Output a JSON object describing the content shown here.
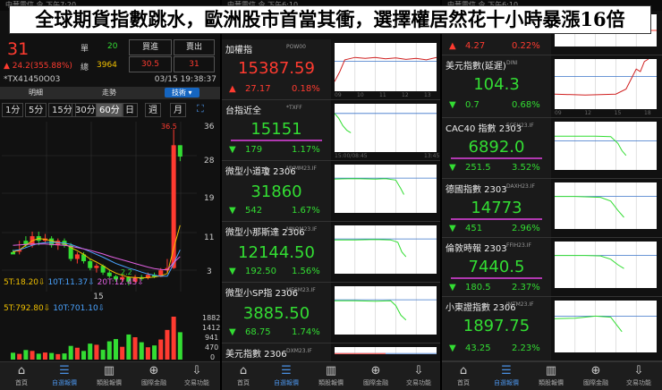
{
  "headline": "全球期貨指數跳水，歐洲股市首當其衝，選擇權居然花十小時暴漲16倍",
  "status": {
    "p1": "中華電信 令 下午7:20",
    "p2": "中華電信 令 下午6:10",
    "p3": "中華電信 令 下午6:10"
  },
  "panel1": {
    "price": "31",
    "change_arrow": "▲",
    "change": "24.2(355.88%)",
    "lbl_single": "單",
    "single": "20",
    "lbl_total": "總",
    "total": "3964",
    "lbl_buy": "買進",
    "buy": "30.5",
    "lbl_sell": "賣出",
    "sell": "31",
    "symbol": "*TX41450O03",
    "datetime": "03/15 19:38:37",
    "tabs": [
      "明細",
      "走勢",
      "技術 ▾"
    ],
    "intervals": [
      "1分",
      "5分",
      "15分",
      "30分",
      "60分",
      "日",
      "週",
      "月"
    ],
    "expand_icon": "⛶",
    "y_axis": [
      "36",
      "28",
      "19",
      "11",
      "3"
    ],
    "high_label": "36.5",
    "low_label": "2.2",
    "ma5": "5T:18.20⇩",
    "ma10": "10T:11.37⇩",
    "ma20": "20T:12.45⇩",
    "vol_top": "15",
    "vol5": "5T:792.80⇩",
    "vol10": "10T:701.10⇩",
    "vol_axis": [
      "1882",
      "1412",
      "941",
      "470",
      "0"
    ]
  },
  "panel2": {
    "rows": [
      {
        "name": "加權指",
        "code": "POW00",
        "price": "15387.59",
        "arrow": "▲",
        "change": "27.17",
        "pct": "0.18%",
        "dir": "up",
        "xt": [
          "09",
          "10",
          "11",
          "12",
          "13"
        ]
      },
      {
        "name": "台指近全",
        "code": "*TXFF",
        "price": "15151",
        "arrow": "▼",
        "change": "179",
        "pct": "1.17%",
        "dir": "down",
        "xt": [
          "15:00/08:45",
          "13:45"
        ]
      },
      {
        "name": "微型小道瓊 2306",
        "code": "MYMM23.IF",
        "price": "31860",
        "arrow": "▼",
        "change": "542",
        "pct": "1.67%",
        "dir": "down"
      },
      {
        "name": "微型小那斯達 2306",
        "code": "MNQM23.IF",
        "price": "12144.50",
        "arrow": "▼",
        "change": "192.50",
        "pct": "1.56%",
        "dir": "down"
      },
      {
        "name": "微型小SP指 2306",
        "code": "MESM23.IF",
        "price": "3885.50",
        "arrow": "▼",
        "change": "68.75",
        "pct": "1.74%",
        "dir": "down"
      },
      {
        "name": "美元指數 2306",
        "code": "DXM23.IF",
        "price": "",
        "arrow": "",
        "change": "",
        "pct": "",
        "dir": "up"
      }
    ],
    "nav": [
      {
        "icon": "⌂",
        "label": "首頁"
      },
      {
        "icon": "☰",
        "label": "自選報價"
      },
      {
        "icon": "▥",
        "label": "類股報價"
      },
      {
        "icon": "⊕",
        "label": "國際金融"
      },
      {
        "icon": "⇩",
        "label": "交易功能"
      }
    ]
  },
  "panel3": {
    "rows": [
      {
        "name": "",
        "code": "",
        "price": "",
        "arrow": "▲",
        "change": "4.27",
        "pct": "0.22%",
        "dir": "up"
      },
      {
        "name": "美元指數(延遲)",
        "code": "DINI",
        "price": "104.3",
        "arrow": "▼",
        "change": "0.7",
        "pct": "0.68%",
        "dir": "down",
        "xt": [
          "09",
          "12",
          "15",
          "18"
        ]
      },
      {
        "name": "CAC40 指數 2303",
        "code": "FCEH23.IF",
        "price": "6892.0",
        "arrow": "▼",
        "change": "251.5",
        "pct": "3.52%",
        "dir": "down"
      },
      {
        "name": "德國指數 2303",
        "code": "DAXH23.IF",
        "price": "14773",
        "arrow": "▼",
        "change": "451",
        "pct": "2.96%",
        "dir": "down"
      },
      {
        "name": "倫敦時報 2303",
        "code": "FFIH23.IF",
        "price": "7440.5",
        "arrow": "▼",
        "change": "180.5",
        "pct": "2.37%",
        "dir": "down"
      },
      {
        "name": "小東證指數 2306",
        "code": "JMTM23.IF",
        "price": "1897.75",
        "arrow": "▼",
        "change": "43.25",
        "pct": "2.23%",
        "dir": "down"
      }
    ]
  },
  "nav": [
    {
      "icon": "⌂",
      "label": "首頁"
    },
    {
      "icon": "☰",
      "label": "自選報價"
    },
    {
      "icon": "▥",
      "label": "類股報價"
    },
    {
      "icon": "⊕",
      "label": "國際金融"
    },
    {
      "icon": "⇩",
      "label": "交易功能"
    }
  ],
  "colors": {
    "up": "#ff3b30",
    "down": "#33dd33",
    "accent": "#4a90e2",
    "ma_bar": "#b038b0"
  }
}
